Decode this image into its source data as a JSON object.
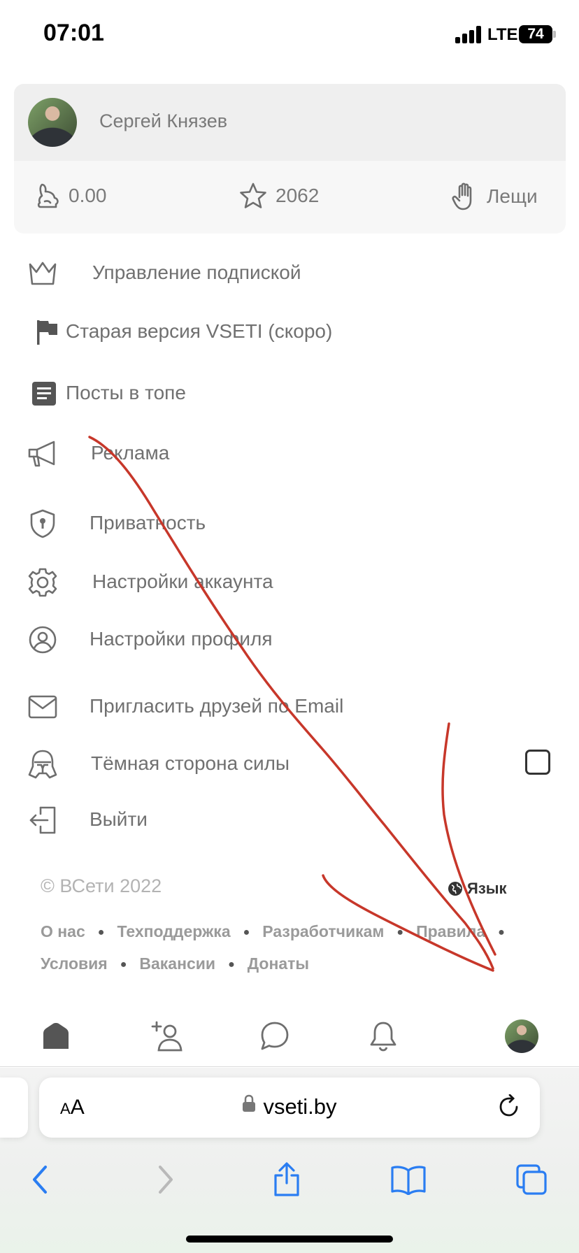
{
  "status_bar": {
    "time": "07:01",
    "network": "LTE",
    "battery": "74"
  },
  "profile": {
    "name": "Сергей Князев",
    "avatar": "user-photo"
  },
  "stats": {
    "balance": "0.00",
    "rating": "2062",
    "leshchi": "Лещи"
  },
  "menu": {
    "subscription": "Управление подпиской",
    "old_version": "Старая версия VSETI (скоро)",
    "top_posts": "Посты в топе",
    "ads": "Реклама",
    "privacy": "Приватность",
    "account_settings": "Настройки аккаунта",
    "profile_settings": "Настройки профиля",
    "invite": "Пригласить друзей по Email",
    "dark_side": "Тёмная сторона силы",
    "logout": "Выйти"
  },
  "footer": {
    "copyright": "© ВСети 2022",
    "language": "Язык",
    "links": [
      "О нас",
      "Техподдержка",
      "Разработчикам",
      "Правила",
      "Условия",
      "Вакансии",
      "Донаты"
    ]
  },
  "browser": {
    "text_size": "AA",
    "url": "vseti.by"
  },
  "colors": {
    "icon": "#6e6e6e",
    "annotation": "#c7372a",
    "url_bar": "#ffffff",
    "safari_accent": "#2a7df2"
  }
}
